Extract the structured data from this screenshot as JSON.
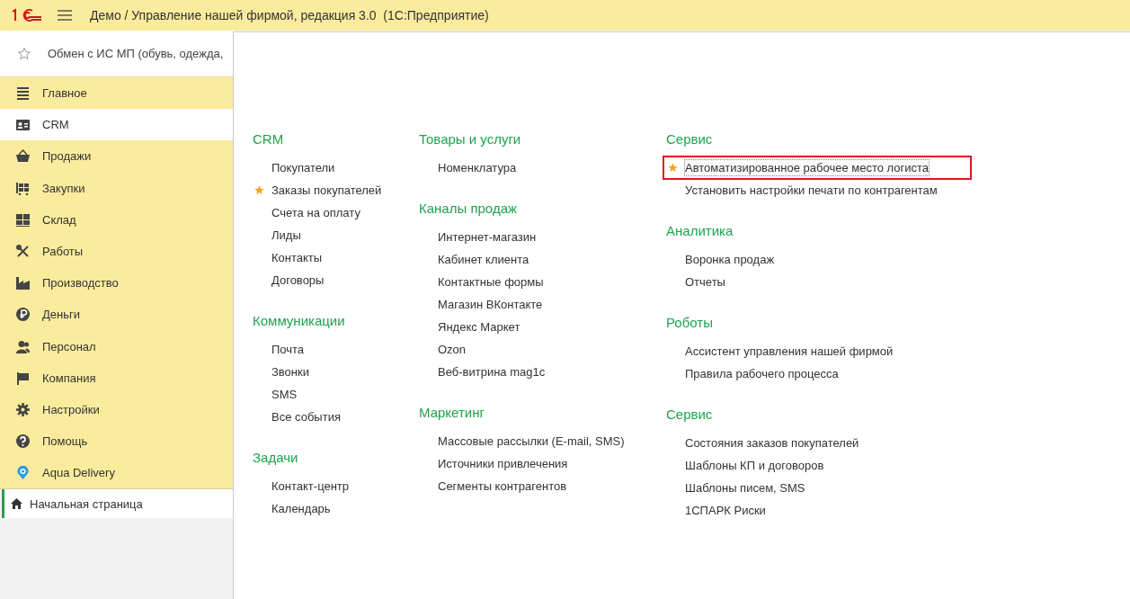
{
  "window": {
    "title": "Демо / Управление нашей фирмой, редакция 3.0  (1С:Предприятие)"
  },
  "favorites_bar": {
    "label": "Обмен с ИС МП (обувь, одежда,"
  },
  "sidebar": {
    "items": [
      {
        "label": "Главное",
        "selected": false
      },
      {
        "label": "CRM",
        "selected": true
      },
      {
        "label": "Продажи",
        "selected": false
      },
      {
        "label": "Закупки",
        "selected": false
      },
      {
        "label": "Склад",
        "selected": false
      },
      {
        "label": "Работы",
        "selected": false
      },
      {
        "label": "Производство",
        "selected": false
      },
      {
        "label": "Деньги",
        "selected": false
      },
      {
        "label": "Персонал",
        "selected": false
      },
      {
        "label": "Компания",
        "selected": false
      },
      {
        "label": "Настройки",
        "selected": false
      },
      {
        "label": "Помощь",
        "selected": false
      },
      {
        "label": "Aqua Delivery",
        "selected": false
      }
    ]
  },
  "open_windows": [
    {
      "label": "Начальная страница",
      "selected": true
    }
  ],
  "columns": [
    [
      {
        "heading": "CRM",
        "items": [
          {
            "label": "Покупатели",
            "favorite": false,
            "focused": false,
            "highlighted": false
          },
          {
            "label": "Заказы покупателей",
            "favorite": true,
            "focused": false,
            "highlighted": false
          },
          {
            "label": "Счета на оплату",
            "favorite": false,
            "focused": false,
            "highlighted": false
          },
          {
            "label": "Лиды",
            "favorite": false,
            "focused": false,
            "highlighted": false
          },
          {
            "label": "Контакты",
            "favorite": false,
            "focused": false,
            "highlighted": false
          },
          {
            "label": "Договоры",
            "favorite": false,
            "focused": false,
            "highlighted": false
          }
        ]
      },
      {
        "heading": "Коммуникации",
        "items": [
          {
            "label": "Почта",
            "favorite": false,
            "focused": false,
            "highlighted": false
          },
          {
            "label": "Звонки",
            "favorite": false,
            "focused": false,
            "highlighted": false
          },
          {
            "label": "SMS",
            "favorite": false,
            "focused": false,
            "highlighted": false
          },
          {
            "label": "Все события",
            "favorite": false,
            "focused": false,
            "highlighted": false
          }
        ]
      },
      {
        "heading": "Задачи",
        "items": [
          {
            "label": "Контакт-центр",
            "favorite": false,
            "focused": false,
            "highlighted": false
          },
          {
            "label": "Календарь",
            "favorite": false,
            "focused": false,
            "highlighted": false
          }
        ]
      }
    ],
    [
      {
        "heading": "Товары и услуги",
        "items": [
          {
            "label": "Номенклатура",
            "favorite": false,
            "focused": false,
            "highlighted": false
          }
        ]
      },
      {
        "heading": "Каналы продаж",
        "items": [
          {
            "label": "Интернет-магазин",
            "favorite": false,
            "focused": false,
            "highlighted": false
          },
          {
            "label": "Кабинет клиента",
            "favorite": false,
            "focused": false,
            "highlighted": false
          },
          {
            "label": "Контактные формы",
            "favorite": false,
            "focused": false,
            "highlighted": false
          },
          {
            "label": "Магазин ВКонтакте",
            "favorite": false,
            "focused": false,
            "highlighted": false
          },
          {
            "label": "Яндекс Маркет",
            "favorite": false,
            "focused": false,
            "highlighted": false
          },
          {
            "label": "Ozon",
            "favorite": false,
            "focused": false,
            "highlighted": false
          },
          {
            "label": "Веб-витрина mag1c",
            "favorite": false,
            "focused": false,
            "highlighted": false
          }
        ]
      },
      {
        "heading": "Маркетинг",
        "items": [
          {
            "label": "Массовые рассылки (E-mail, SMS)",
            "favorite": false,
            "focused": false,
            "highlighted": false
          },
          {
            "label": "Источники привлечения",
            "favorite": false,
            "focused": false,
            "highlighted": false
          },
          {
            "label": "Сегменты контрагентов",
            "favorite": false,
            "focused": false,
            "highlighted": false
          }
        ]
      }
    ],
    [
      {
        "heading": "Сервис",
        "items": [
          {
            "label": "Автоматизированное рабочее место логиста",
            "favorite": true,
            "focused": true,
            "highlighted": true
          },
          {
            "label": "Установить настройки печати по контрагентам",
            "favorite": false,
            "focused": false,
            "highlighted": false
          }
        ]
      },
      {
        "heading": "Аналитика",
        "items": [
          {
            "label": "Воронка продаж",
            "favorite": false,
            "focused": false,
            "highlighted": false
          },
          {
            "label": "Отчеты",
            "favorite": false,
            "focused": false,
            "highlighted": false
          }
        ]
      },
      {
        "heading": "Роботы",
        "items": [
          {
            "label": "Ассистент управления нашей фирмой",
            "favorite": false,
            "focused": false,
            "highlighted": false
          },
          {
            "label": "Правила рабочего процесса",
            "favorite": false,
            "focused": false,
            "highlighted": false
          }
        ]
      },
      {
        "heading": "Сервис",
        "items": [
          {
            "label": "Состояния заказов покупателей",
            "favorite": false,
            "focused": false,
            "highlighted": false
          },
          {
            "label": "Шаблоны КП и договоров",
            "favorite": false,
            "focused": false,
            "highlighted": false
          },
          {
            "label": "Шаблоны писем, SMS",
            "favorite": false,
            "focused": false,
            "highlighted": false
          },
          {
            "label": "1СПАРК Риски",
            "favorite": false,
            "focused": false,
            "highlighted": false
          }
        ]
      }
    ]
  ]
}
